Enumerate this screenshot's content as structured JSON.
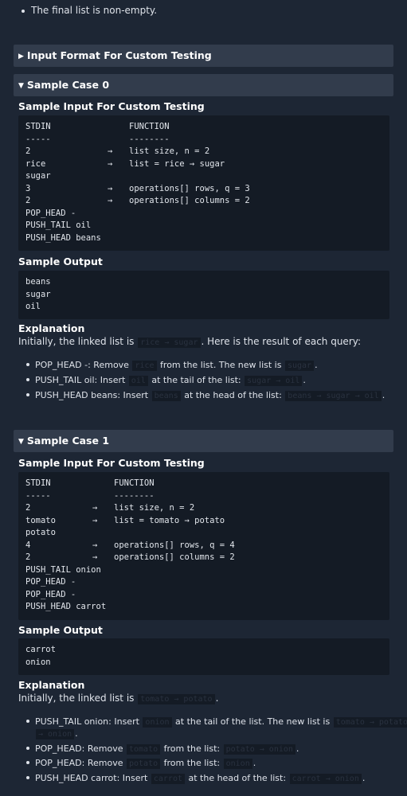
{
  "top_bullet": "The final list is non-empty.",
  "input_format_header": "Input Format For Custom Testing",
  "case0": {
    "header": "Sample Case 0",
    "input_title": "Sample Input For Custom Testing",
    "input_lines": [
      {
        "left": "STDIN",
        "arrow": "",
        "right": "FUNCTION"
      },
      {
        "left": "-----",
        "arrow": "",
        "right": "--------"
      },
      {
        "left": "2",
        "arrow": "→",
        "right": "list size, n = 2"
      },
      {
        "left": "rice",
        "arrow": "→",
        "right": "list = rice → sugar"
      },
      {
        "left": "sugar",
        "arrow": "",
        "right": ""
      },
      {
        "left": "3",
        "arrow": "→",
        "right": "operations[] rows, q = 3"
      },
      {
        "left": "2",
        "arrow": "→",
        "right": "operations[] columns = 2"
      },
      {
        "left": "POP_HEAD -",
        "arrow": "",
        "right": ""
      },
      {
        "left": "PUSH_TAIL oil",
        "arrow": "",
        "right": ""
      },
      {
        "left": "PUSH_HEAD beans",
        "arrow": "",
        "right": ""
      }
    ],
    "output_title": "Sample Output",
    "output_lines": [
      "beans",
      "sugar",
      "oil"
    ],
    "explanation_title": "Explanation",
    "explanation_pre": "Initially, the linked list is",
    "explanation_chip": "rice → sugar",
    "explanation_post": ". Here is the result of each query:",
    "items": [
      {
        "a": "POP_HEAD -: Remove",
        "c1": "rice",
        "b": "from the list. The new list is",
        "c2": "sugar",
        "end": "."
      },
      {
        "a": "PUSH_TAIL oil: Insert",
        "c1": "oil",
        "b": "at the tail of the list:",
        "c2": "sugar → oil",
        "end": "."
      },
      {
        "a": "PUSH_HEAD beans: Insert",
        "c1": "beans",
        "b": "at the head of the list:",
        "c2": "beans → sugar → oil",
        "end": "."
      }
    ]
  },
  "case1": {
    "header": "Sample Case 1",
    "input_title": "Sample Input For Custom Testing",
    "input_lines": [
      {
        "left": "STDIN",
        "arrow": "",
        "right": "FUNCTION"
      },
      {
        "left": "-----",
        "arrow": "",
        "right": "--------"
      },
      {
        "left": "2",
        "arrow": "→",
        "right": "list size, n = 2"
      },
      {
        "left": "tomato",
        "arrow": "→",
        "right": "list = tomato → potato"
      },
      {
        "left": "potato",
        "arrow": "",
        "right": ""
      },
      {
        "left": "4",
        "arrow": "→",
        "right": "operations[] rows, q = 4"
      },
      {
        "left": "2",
        "arrow": "→",
        "right": "operations[] columns = 2"
      },
      {
        "left": "PUSH_TAIL onion",
        "arrow": "",
        "right": ""
      },
      {
        "left": "POP_HEAD -",
        "arrow": "",
        "right": ""
      },
      {
        "left": "POP_HEAD -",
        "arrow": "",
        "right": ""
      },
      {
        "left": "PUSH_HEAD carrot",
        "arrow": "",
        "right": ""
      }
    ],
    "output_title": "Sample Output",
    "output_lines": [
      "carrot",
      "onion"
    ],
    "explanation_title": "Explanation",
    "explanation_pre": "Initially, the linked list is",
    "explanation_chip": "tomato → potato",
    "explanation_post": ".",
    "items": [
      {
        "a": "PUSH_TAIL onion: Insert",
        "c1": "onion",
        "b": "at the tail of the list. The new list is",
        "c2": "tomato → potato",
        "c2b": "→ onion",
        "end": "."
      },
      {
        "a": "POP_HEAD: Remove",
        "c1": "tomato",
        "b": "from the list:",
        "c2": "potato → onion",
        "end": "."
      },
      {
        "a": "POP_HEAD: Remove",
        "c1": "potato",
        "b": "from the list:",
        "c2": "onion",
        "end": "."
      },
      {
        "a": "PUSH_HEAD carrot: Insert",
        "c1": "carrot",
        "b": "at the head of the list:",
        "c2": "carrot → onion",
        "end": "."
      }
    ]
  }
}
